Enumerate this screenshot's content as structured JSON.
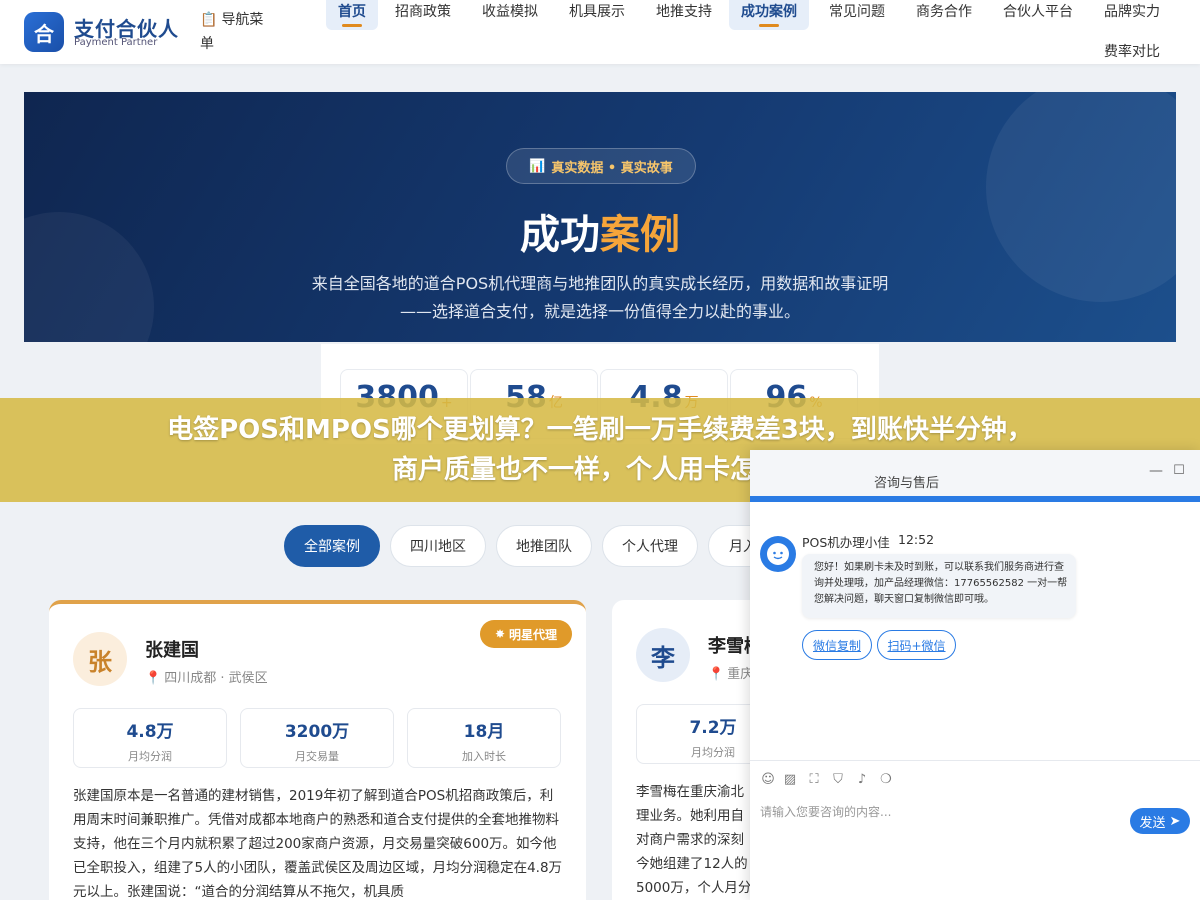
{
  "header": {
    "logo_char": "合",
    "brand_name": "支付合伙人",
    "brand_sub": "Payment Partner",
    "nav_menu_label": "导航菜单",
    "nav": [
      {
        "label": "首页",
        "active": true
      },
      {
        "label": "招商政策"
      },
      {
        "label": "收益模拟"
      },
      {
        "label": "机具展示"
      },
      {
        "label": "地推支持"
      },
      {
        "label": "成功案例",
        "active": true
      },
      {
        "label": "常见问题"
      },
      {
        "label": "商务合作"
      },
      {
        "label": "合伙人平台"
      },
      {
        "label": "品牌实力"
      },
      {
        "label": "费率对比"
      }
    ]
  },
  "hero": {
    "badge": "真实数据 • 真实故事",
    "title_main": "成功",
    "title_highlight": "案例",
    "description": "来自全国各地的道合POS机代理商与地推团队的真实成长经历，用数据和故事证明——选择道合支付，就是选择一份值得全力以赴的事业。"
  },
  "stats": [
    {
      "value": "3800",
      "unit": "+"
    },
    {
      "value": "58",
      "unit": "亿"
    },
    {
      "value": "4.8",
      "unit": "万"
    },
    {
      "value": "96",
      "unit": "%"
    }
  ],
  "filters": [
    "全部案例",
    "四川地区",
    "地推团队",
    "个人代理",
    "月入"
  ],
  "cards": [
    {
      "avatar_char": "张",
      "name": "张建国",
      "location": "四川成都 · 武侯区",
      "badge": "明星代理",
      "metrics": [
        {
          "value": "4.8万",
          "label": "月均分润"
        },
        {
          "value": "3200万",
          "label": "月交易量"
        },
        {
          "value": "18月",
          "label": "加入时长"
        }
      ],
      "story": "张建国原本是一名普通的建材销售，2019年初了解到道合POS机招商政策后，利用周末时间兼职推广。凭借对成都本地商户的熟悉和道合支付提供的全套地推物料支持，他在三个月内就积累了超过200家商户资源，月交易量突破600万。如今他已全职投入，组建了5人的小团队，覆盖武侯区及周边区域，月均分润稳定在4.8万元以上。张建国说：“道合的分润结算从不拖欠，机具质"
    },
    {
      "avatar_char": "李",
      "name": "李雪梅",
      "location": "重庆",
      "metrics": [
        {
          "value": "7.2万",
          "label": "月均分润"
        }
      ],
      "story_lines": [
        "李雪梅在重庆渝北",
        "理业务。她利用自",
        "对商户需求的深刻",
        "今她组建了12人的",
        "5000万，个人月分"
      ]
    }
  ],
  "banner": {
    "line1": "电签POS和MPOS哪个更划算？一笔刷一万手续费差3块，到账快半分钟，",
    "line2": "商户质量也不一样，个人用卡怎么选"
  },
  "chat": {
    "title": "咨询与售后",
    "bot_name": "POS机办理小佳",
    "time": "12:52",
    "message": "您好！如果刷卡未及时到账，可以联系我们服务商进行查询并处理哦，加产品经理微信：17765562582 一对一帮您解决问题，聊天窗口复制微信即可哦。",
    "quick_replies": [
      "微信复制",
      "扫码+微信"
    ],
    "input_placeholder": "请输入您要咨询的内容...",
    "send_label": "发送"
  }
}
